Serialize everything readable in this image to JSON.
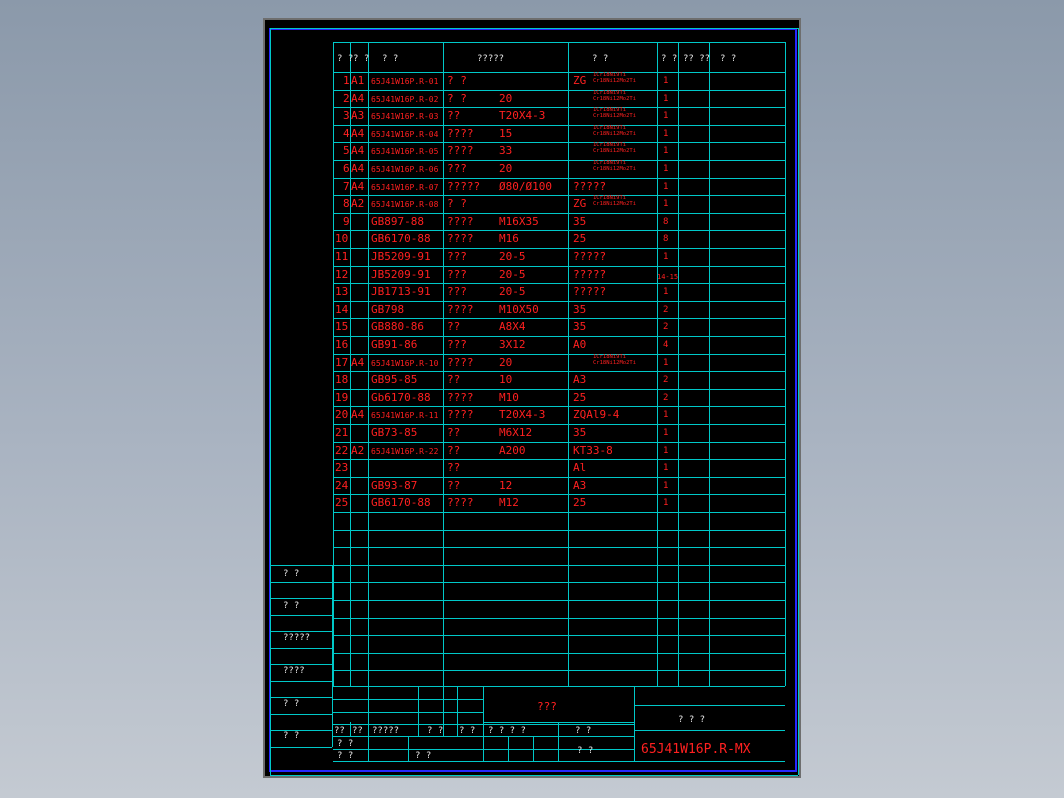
{
  "colors": {
    "line": "#00c8c8",
    "text_red": "#ff2020",
    "text_white": "#e8e8e8",
    "frame_blue": "#2828ff"
  },
  "header": {
    "seq": "? ?",
    "size": "? ?",
    "code": "?   ?",
    "name": "?????",
    "material": "?     ?",
    "qty": "? ?",
    "weight": "?? ??",
    "remark": "?      ?"
  },
  "rows": [
    {
      "no": "1",
      "sz": "A1",
      "code": "65J41W16P.R-01",
      "name": "?   ?",
      "spec": "",
      "mat": "ZG",
      "mat2": [
        "1Cr18Ni9Ti",
        "Cr18Ni12Mo2Ti"
      ],
      "qty": "1"
    },
    {
      "no": "2",
      "sz": "A4",
      "code": "65J41W16P.R-02",
      "name": "?   ?",
      "spec": "20",
      "mat": "",
      "mat2": [
        "1Cr18Ni9Ti",
        "Cr18Ni12Mo2Ti"
      ],
      "qty": "1"
    },
    {
      "no": "3",
      "sz": "A3",
      "code": "65J41W16P.R-03",
      "name": "??",
      "spec": "T20X4-3",
      "mat": "",
      "mat2": [
        "1Cr18Ni9Ti",
        "Cr18Ni12Mo2Ti"
      ],
      "qty": "1"
    },
    {
      "no": "4",
      "sz": "A4",
      "code": "65J41W16P.R-04",
      "name": "????",
      "spec": "15",
      "mat": "",
      "mat2": [
        "1Cr18Ni9Ti",
        "Cr18Ni12Mo2Ti"
      ],
      "qty": "1"
    },
    {
      "no": "5",
      "sz": "A4",
      "code": "65J41W16P.R-05",
      "name": "????",
      "spec": "33",
      "mat": "",
      "mat2": [
        "1Cr18Ni9Ti",
        "Cr18Ni12Mo2Ti"
      ],
      "qty": "1"
    },
    {
      "no": "6",
      "sz": "A4",
      "code": "65J41W16P.R-06",
      "name": "???",
      "spec": "20",
      "mat": "",
      "mat2": [
        "1Cr18Ni9Ti",
        "Cr18Ni12Mo2Ti"
      ],
      "qty": "1"
    },
    {
      "no": "7",
      "sz": "A4",
      "code": "65J41W16P.R-07",
      "name": "?????",
      "spec": "Ø80/Ø100",
      "mat": "?????",
      "mat2": [],
      "qty": "1"
    },
    {
      "no": "8",
      "sz": "A2",
      "code": "65J41W16P.R-08",
      "name": "?   ?",
      "spec": "",
      "mat": "ZG",
      "mat2": [
        "1Cr18Ni9Ti",
        "Cr18Ni12Mo2Ti"
      ],
      "qty": "1"
    },
    {
      "no": "9",
      "sz": "",
      "code": "GB897-88",
      "name": "????",
      "spec": "M16X35",
      "mat": "35",
      "mat2": [],
      "qty": "8"
    },
    {
      "no": "10",
      "sz": "",
      "code": "GB6170-88",
      "name": "????",
      "spec": "M16",
      "mat": "25",
      "mat2": [],
      "qty": "8"
    },
    {
      "no": "11",
      "sz": "",
      "code": "JB5209-91",
      "name": "???",
      "spec": "20-5",
      "mat": "?????",
      "mat2": [],
      "qty": "1"
    },
    {
      "no": "12",
      "sz": "",
      "code": "JB5209-91",
      "name": "???",
      "spec": "20-5",
      "mat": "?????",
      "mat2": [],
      "qty": "14-15"
    },
    {
      "no": "13",
      "sz": "",
      "code": "JB1713-91",
      "name": "???",
      "spec": "20-5",
      "mat": "?????",
      "mat2": [],
      "qty": "1"
    },
    {
      "no": "14",
      "sz": "",
      "code": "GB798",
      "name": "????",
      "spec": "M10X50",
      "mat": "35",
      "mat2": [],
      "qty": "2"
    },
    {
      "no": "15",
      "sz": "",
      "code": "GB880-86",
      "name": "??",
      "spec": "A8X4",
      "mat": "35",
      "mat2": [],
      "qty": "2"
    },
    {
      "no": "16",
      "sz": "",
      "code": "GB91-86",
      "name": "???",
      "spec": "3X12",
      "mat": "A0",
      "mat2": [],
      "qty": "4"
    },
    {
      "no": "17",
      "sz": "A4",
      "code": "65J41W16P.R-10",
      "name": "????",
      "spec": "20",
      "mat": "",
      "mat2": [
        "1Cr18Ni9Ti",
        "Cr18Ni12Mo2Ti"
      ],
      "qty": "1"
    },
    {
      "no": "18",
      "sz": "",
      "code": "GB95-85",
      "name": "??",
      "spec": "10",
      "mat": "A3",
      "mat2": [],
      "qty": "2"
    },
    {
      "no": "19",
      "sz": "",
      "code": "Gb6170-88",
      "name": "????",
      "spec": "M10",
      "mat": "25",
      "mat2": [],
      "qty": "2"
    },
    {
      "no": "20",
      "sz": "A4",
      "code": "65J41W16P.R-11",
      "name": "????",
      "spec": "T20X4-3",
      "mat": "ZQAl9-4",
      "mat2": [],
      "qty": "1"
    },
    {
      "no": "21",
      "sz": "",
      "code": "GB73-85",
      "name": "??",
      "spec": "M6X12",
      "mat": "35",
      "mat2": [],
      "qty": "1"
    },
    {
      "no": "22",
      "sz": "A2",
      "code": "65J41W16P.R-22",
      "name": "??",
      "spec": "A200",
      "mat": "KT33-8",
      "mat2": [],
      "qty": "1"
    },
    {
      "no": "23",
      "sz": "",
      "code": "",
      "name": "??",
      "spec": "",
      "mat": "Al",
      "mat2": [],
      "qty": "1"
    },
    {
      "no": "24",
      "sz": "",
      "code": "GB93-87",
      "name": "??",
      "spec": "12",
      "mat": "A3",
      "mat2": [],
      "qty": "1"
    },
    {
      "no": "25",
      "sz": "",
      "code": "GB6170-88",
      "name": "????",
      "spec": "M12",
      "mat": "25",
      "mat2": [],
      "qty": "1"
    }
  ],
  "side_labels": [
    "?   ?",
    "?   ?",
    "?????",
    "????",
    "?   ?",
    "?   ?"
  ],
  "title_block": {
    "center_title": "???",
    "right_title": "?   ?   ?",
    "drawing_no": "65J41W16P.R-MX",
    "row1": [
      "??",
      "??",
      "?????",
      "?   ?",
      "?   ?"
    ],
    "row2": [
      "?   ?",
      "?   ?"
    ],
    "row3": [
      "?   ?",
      "?   ?"
    ],
    "scale_row": [
      "?   ?   ?   ?",
      "?   ?"
    ],
    "bottom_right": "?      ?"
  }
}
